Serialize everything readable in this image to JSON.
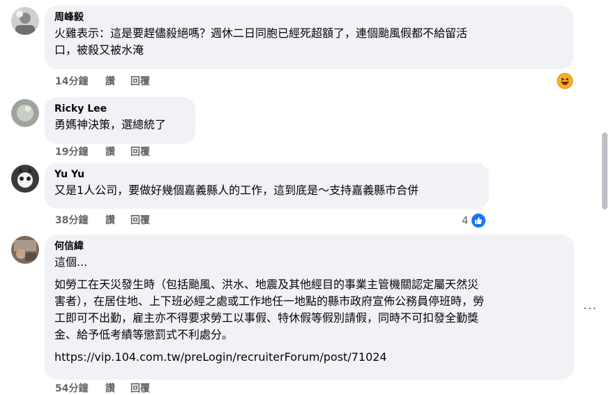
{
  "comments": [
    {
      "author": "周峰毅",
      "lines": [
        "火雞表示：這是要趕儘殺絕嗎？週休二日同胞已經死超額了，連個颱風假都不給留活\n口，被殺又被水淹"
      ],
      "time": "14分鐘",
      "like": "讚",
      "reply": "回覆",
      "reaction": "haha-emoji-icon"
    },
    {
      "author": "Ricky Lee",
      "lines": [
        "勇媽神決策，選總統了"
      ],
      "time": "19分鐘",
      "like": "讚",
      "reply": "回覆"
    },
    {
      "author": "Yu Yu",
      "lines": [
        "又是1人公司，要做好幾個嘉義縣人的工作，這到底是～支持嘉義縣市合併"
      ],
      "time": "38分鐘",
      "like": "讚",
      "reply": "回覆",
      "reaction_count": "4",
      "reaction": "like-icon"
    },
    {
      "author": "何信緯",
      "lines": [
        "這個...",
        "如勞工在天災發生時（包括颱風、洪水、地震及其他經目的事業主管機關認定屬天然災\n害者），在居住地、上下班必經之處或工作地任一地點的縣市政府宣佈公務員停班時，勞\n工即可不出勤，雇主亦不得要求勞工以事假、特休假等假別請假，同時不可扣發全勤獎\n金、給予低考績等懲罰式不利處分。",
        "https://vip.104.com.tw/preLogin/recruiterForum/post/71024"
      ],
      "time": "54分鐘",
      "like": "讚",
      "reply": "回覆"
    }
  ],
  "more_label": "···",
  "colors": {
    "bubble": "#f0f2f5",
    "meta": "#65676b",
    "like_blue": "#1877f2"
  }
}
